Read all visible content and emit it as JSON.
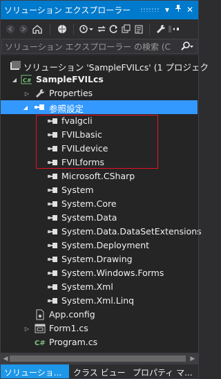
{
  "window": {
    "title": "ソリューション エクスプローラー",
    "pin_icon": "pin-icon",
    "close_icon": "close-icon"
  },
  "search": {
    "placeholder": "ソリューション エクスプローラー の検索 (C",
    "icon": "search-icon"
  },
  "tree": {
    "solution": "ソリューション 'SampleFVILcs' (1 プロジェク",
    "project": "SampleFVILcs",
    "properties": "Properties",
    "references": "参照設定",
    "refs": [
      "fvalgcli",
      "FVILbasic",
      "FVILdevice",
      "FVILforms",
      "Microsoft.CSharp",
      "System",
      "System.Core",
      "System.Data",
      "System.Data.DataSetExtensions",
      "System.Deployment",
      "System.Drawing",
      "System.Windows.Forms",
      "System.Xml",
      "System.Xml.Linq"
    ],
    "app_config": "App.config",
    "form1": "Form1.cs",
    "program": "Program.cs"
  },
  "tabs": {
    "solution": "ソリューショ...",
    "class_view": "クラス ビュー",
    "properties": "プロパティ マ..."
  },
  "colors": {
    "accent": "#007acc",
    "selection": "#3399ff",
    "highlight_box": "#e81123"
  }
}
